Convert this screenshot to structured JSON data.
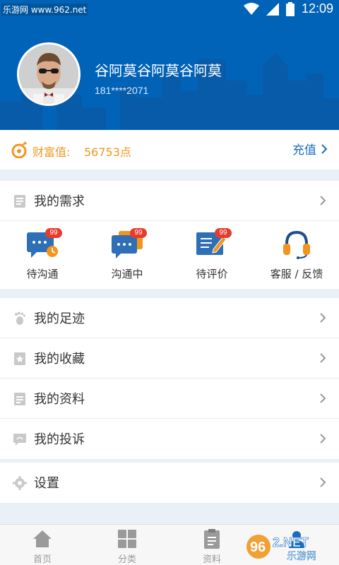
{
  "status_bar": {
    "watermark": "乐游网 www.962.net",
    "time": "12:09"
  },
  "profile": {
    "name": "谷阿莫谷阿莫谷阿莫",
    "phone": "181****2071"
  },
  "wealth": {
    "label": "财富值:",
    "value": "56753点",
    "recharge_label": "充值"
  },
  "needs": {
    "title": "我的需求",
    "items": [
      {
        "label": "待沟通",
        "badge": "99",
        "icon": "chat-clock-icon"
      },
      {
        "label": "沟通中",
        "badge": "99",
        "icon": "chat-bubbles-icon"
      },
      {
        "label": "待评价",
        "badge": "99",
        "icon": "review-edit-icon"
      },
      {
        "label": "客服 / 反馈",
        "icon": "headset-icon"
      }
    ]
  },
  "menu": {
    "footprint": "我的足迹",
    "favorites": "我的收藏",
    "profile_info": "我的资料",
    "complaints": "我的投诉",
    "settings": "设置"
  },
  "bottom_nav": [
    {
      "label": "首页",
      "icon": "home-icon"
    },
    {
      "label": "分类",
      "icon": "category-icon"
    },
    {
      "label": "资料",
      "icon": "clipboard-icon"
    },
    {
      "label": "",
      "icon": "user-icon"
    }
  ],
  "watermark_logo": "962.NET 乐游网",
  "colors": {
    "brand_blue": "#0063b8",
    "wealth_orange": "#f0961e",
    "badge_red": "#e83b2d",
    "link_blue": "#1a6ec0"
  }
}
